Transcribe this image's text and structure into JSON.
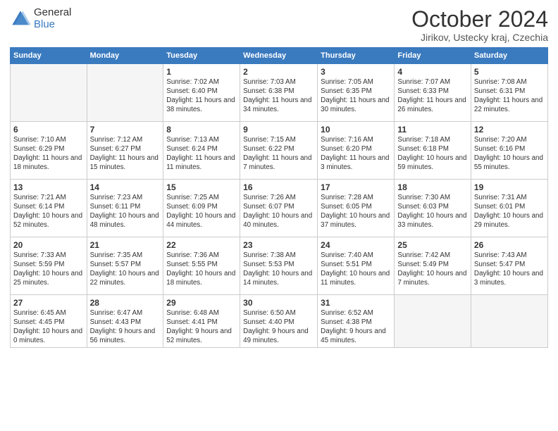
{
  "header": {
    "logo_line1": "General",
    "logo_line2": "Blue",
    "month": "October 2024",
    "location": "Jirikov, Ustecky kraj, Czechia"
  },
  "days_of_week": [
    "Sunday",
    "Monday",
    "Tuesday",
    "Wednesday",
    "Thursday",
    "Friday",
    "Saturday"
  ],
  "weeks": [
    [
      {
        "day": "",
        "info": ""
      },
      {
        "day": "",
        "info": ""
      },
      {
        "day": "1",
        "info": "Sunrise: 7:02 AM\nSunset: 6:40 PM\nDaylight: 11 hours and 38 minutes."
      },
      {
        "day": "2",
        "info": "Sunrise: 7:03 AM\nSunset: 6:38 PM\nDaylight: 11 hours and 34 minutes."
      },
      {
        "day": "3",
        "info": "Sunrise: 7:05 AM\nSunset: 6:35 PM\nDaylight: 11 hours and 30 minutes."
      },
      {
        "day": "4",
        "info": "Sunrise: 7:07 AM\nSunset: 6:33 PM\nDaylight: 11 hours and 26 minutes."
      },
      {
        "day": "5",
        "info": "Sunrise: 7:08 AM\nSunset: 6:31 PM\nDaylight: 11 hours and 22 minutes."
      }
    ],
    [
      {
        "day": "6",
        "info": "Sunrise: 7:10 AM\nSunset: 6:29 PM\nDaylight: 11 hours and 18 minutes."
      },
      {
        "day": "7",
        "info": "Sunrise: 7:12 AM\nSunset: 6:27 PM\nDaylight: 11 hours and 15 minutes."
      },
      {
        "day": "8",
        "info": "Sunrise: 7:13 AM\nSunset: 6:24 PM\nDaylight: 11 hours and 11 minutes."
      },
      {
        "day": "9",
        "info": "Sunrise: 7:15 AM\nSunset: 6:22 PM\nDaylight: 11 hours and 7 minutes."
      },
      {
        "day": "10",
        "info": "Sunrise: 7:16 AM\nSunset: 6:20 PM\nDaylight: 11 hours and 3 minutes."
      },
      {
        "day": "11",
        "info": "Sunrise: 7:18 AM\nSunset: 6:18 PM\nDaylight: 10 hours and 59 minutes."
      },
      {
        "day": "12",
        "info": "Sunrise: 7:20 AM\nSunset: 6:16 PM\nDaylight: 10 hours and 55 minutes."
      }
    ],
    [
      {
        "day": "13",
        "info": "Sunrise: 7:21 AM\nSunset: 6:14 PM\nDaylight: 10 hours and 52 minutes."
      },
      {
        "day": "14",
        "info": "Sunrise: 7:23 AM\nSunset: 6:11 PM\nDaylight: 10 hours and 48 minutes."
      },
      {
        "day": "15",
        "info": "Sunrise: 7:25 AM\nSunset: 6:09 PM\nDaylight: 10 hours and 44 minutes."
      },
      {
        "day": "16",
        "info": "Sunrise: 7:26 AM\nSunset: 6:07 PM\nDaylight: 10 hours and 40 minutes."
      },
      {
        "day": "17",
        "info": "Sunrise: 7:28 AM\nSunset: 6:05 PM\nDaylight: 10 hours and 37 minutes."
      },
      {
        "day": "18",
        "info": "Sunrise: 7:30 AM\nSunset: 6:03 PM\nDaylight: 10 hours and 33 minutes."
      },
      {
        "day": "19",
        "info": "Sunrise: 7:31 AM\nSunset: 6:01 PM\nDaylight: 10 hours and 29 minutes."
      }
    ],
    [
      {
        "day": "20",
        "info": "Sunrise: 7:33 AM\nSunset: 5:59 PM\nDaylight: 10 hours and 25 minutes."
      },
      {
        "day": "21",
        "info": "Sunrise: 7:35 AM\nSunset: 5:57 PM\nDaylight: 10 hours and 22 minutes."
      },
      {
        "day": "22",
        "info": "Sunrise: 7:36 AM\nSunset: 5:55 PM\nDaylight: 10 hours and 18 minutes."
      },
      {
        "day": "23",
        "info": "Sunrise: 7:38 AM\nSunset: 5:53 PM\nDaylight: 10 hours and 14 minutes."
      },
      {
        "day": "24",
        "info": "Sunrise: 7:40 AM\nSunset: 5:51 PM\nDaylight: 10 hours and 11 minutes."
      },
      {
        "day": "25",
        "info": "Sunrise: 7:42 AM\nSunset: 5:49 PM\nDaylight: 10 hours and 7 minutes."
      },
      {
        "day": "26",
        "info": "Sunrise: 7:43 AM\nSunset: 5:47 PM\nDaylight: 10 hours and 3 minutes."
      }
    ],
    [
      {
        "day": "27",
        "info": "Sunrise: 6:45 AM\nSunset: 4:45 PM\nDaylight: 10 hours and 0 minutes."
      },
      {
        "day": "28",
        "info": "Sunrise: 6:47 AM\nSunset: 4:43 PM\nDaylight: 9 hours and 56 minutes."
      },
      {
        "day": "29",
        "info": "Sunrise: 6:48 AM\nSunset: 4:41 PM\nDaylight: 9 hours and 52 minutes."
      },
      {
        "day": "30",
        "info": "Sunrise: 6:50 AM\nSunset: 4:40 PM\nDaylight: 9 hours and 49 minutes."
      },
      {
        "day": "31",
        "info": "Sunrise: 6:52 AM\nSunset: 4:38 PM\nDaylight: 9 hours and 45 minutes."
      },
      {
        "day": "",
        "info": ""
      },
      {
        "day": "",
        "info": ""
      }
    ]
  ]
}
